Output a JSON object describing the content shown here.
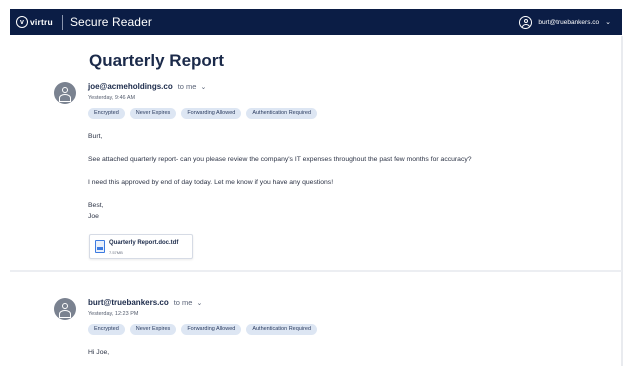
{
  "header": {
    "logo_glyph": "v",
    "logo_text": "virtru",
    "app_title": "Secure Reader",
    "user_email": "burt@truebankers.co",
    "user_chevron": "⌄",
    "icons": {
      "logo": "virtru-logo-icon",
      "user": "user-circle-icon",
      "chevron": "chevron-down-icon"
    }
  },
  "subject": "Quarterly Report",
  "badges": [
    "Encrypted",
    "Never Expires",
    "Forwarding Allowed",
    "Authentication Required"
  ],
  "messages": [
    {
      "sender": "joe@acmeholdings.co",
      "recipient": "to me",
      "chevron": "⌄",
      "timestamp": "Yesterday, 9:46 AM",
      "body": {
        "greeting": "Burt,",
        "line1": "See attached quarterly report- can you please review the company's IT expenses throughout the past few months for accuracy?",
        "line2": "I need this approved by end of day today. Let me know if you have any questions!",
        "closing": "Best,",
        "signature": "Joe"
      },
      "attachment": {
        "name": "Quarterly Report.doc.tdf",
        "size": "7.57MB",
        "icon": "document-file-icon"
      }
    },
    {
      "sender": "burt@truebankers.co",
      "recipient": "to me",
      "chevron": "⌄",
      "timestamp": "Yesterday, 12:23 PM",
      "body": {
        "greeting": "Hi Joe,"
      }
    }
  ],
  "colors": {
    "header_bg": "#0b1d45",
    "badge_bg": "#dde6f3",
    "avatar_bg": "#7a8290"
  }
}
